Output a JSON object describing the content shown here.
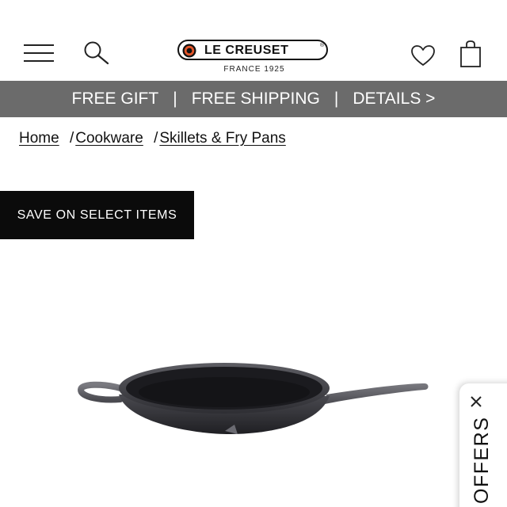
{
  "header": {
    "logo_text": "LE CREUSET",
    "logo_registered": "®",
    "logo_subtext": "FRANCE 1925",
    "icons": {
      "menu": "hamburger-menu-icon",
      "search": "search-icon",
      "wishlist": "heart-icon",
      "bag": "shopping-bag-icon"
    }
  },
  "promo_bar": {
    "item1": "FREE GIFT",
    "separator": "|",
    "item2": "FREE SHIPPING",
    "item3": "DETAILS >",
    "background": "#6b6b6b"
  },
  "breadcrumb": {
    "items": [
      "Home",
      "Cookware",
      "Skillets & Fry Pans"
    ],
    "separator": "/"
  },
  "sale_badge": {
    "label": "SAVE ON SELECT ITEMS"
  },
  "offers_tab": {
    "label": "OFFERS",
    "close_icon": "close-icon"
  },
  "colors": {
    "promo_bar": "#6b6b6b",
    "badge": "#0b0b0b",
    "brand_orange": "#e3562a"
  }
}
